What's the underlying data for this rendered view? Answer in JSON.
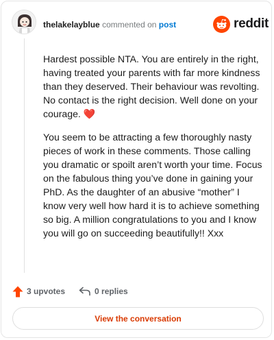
{
  "header": {
    "username": "thelakelayblue",
    "commented_on": "commented on",
    "post_link": "post",
    "brand": "reddit",
    "brand_color": "#ff4500"
  },
  "comment": {
    "paragraph1": "Hardest possible NTA. You are entirely in the right, having treated your parents with far more kindness than they deserved. Their behaviour was revolting. No contact is the right decision. Well done on your courage. ",
    "heart": "❤️",
    "paragraph2": "You seem to be attracting a few thoroughly nasty pieces of work in these comments. Those calling you dramatic or spoilt aren’t worth your time. Focus on the fabulous thing you’ve done in gaining your PhD. As the daughter of an abusive “mother” I know very well how hard it is to achieve something so big. A million congratulations to you and I know you will go on succeeding beautifully!! Xxx"
  },
  "actions": {
    "upvotes": "3 upvotes",
    "replies": "0 replies",
    "upvote_icon": "upvote-arrow-icon",
    "reply_icon": "reply-arrow-icon",
    "upvote_color": "#ff4500"
  },
  "footer": {
    "view_conversation": "View the conversation"
  }
}
